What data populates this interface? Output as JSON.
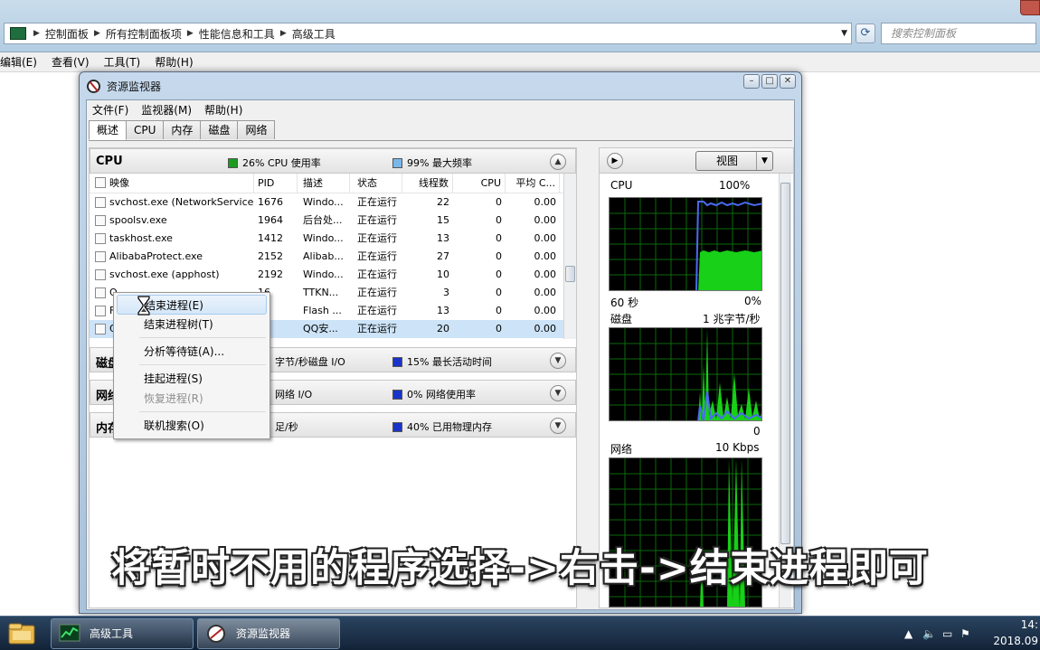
{
  "explorer": {
    "breadcrumbs": [
      "控制面板",
      "所有控制面板项",
      "性能信息和工具",
      "高级工具"
    ],
    "search_placeholder": "搜索控制面板",
    "menu": [
      "编辑(E)",
      "查看(V)",
      "工具(T)",
      "帮助(H)"
    ]
  },
  "resmon": {
    "title": "资源监视器",
    "menu": [
      "文件(F)",
      "监视器(M)",
      "帮助(H)"
    ],
    "tabs": [
      "概述",
      "CPU",
      "内存",
      "磁盘",
      "网络"
    ],
    "active_tab": "概述",
    "cpu_panel": {
      "name": "CPU",
      "usage": "26% CPU 使用率",
      "usage_color": "#1c9c1c",
      "freq": "99% 最大频率",
      "freq_color": "#7ab8ea",
      "columns": [
        "映像",
        "PID",
        "描述",
        "状态",
        "线程数",
        "CPU",
        "平均 C..."
      ],
      "rows": [
        {
          "image": "svchost.exe (NetworkService)",
          "pid": "1676",
          "desc": "Windo...",
          "status": "正在运行",
          "threads": "22",
          "cpu": "0",
          "avg": "0.00"
        },
        {
          "image": "spoolsv.exe",
          "pid": "1964",
          "desc": "后台处...",
          "status": "正在运行",
          "threads": "15",
          "cpu": "0",
          "avg": "0.00"
        },
        {
          "image": "taskhost.exe",
          "pid": "1412",
          "desc": "Windo...",
          "status": "正在运行",
          "threads": "13",
          "cpu": "0",
          "avg": "0.00"
        },
        {
          "image": "AlibabaProtect.exe",
          "pid": "2152",
          "desc": "Alibab...",
          "status": "正在运行",
          "threads": "27",
          "cpu": "0",
          "avg": "0.00"
        },
        {
          "image": "svchost.exe (apphost)",
          "pid": "2192",
          "desc": "Windo...",
          "status": "正在运行",
          "threads": "10",
          "cpu": "0",
          "avg": "0.00"
        },
        {
          "image": "Q",
          "pid": "16",
          "desc": "TTKN...",
          "status": "正在运行",
          "threads": "3",
          "cpu": "0",
          "avg": "0.00"
        },
        {
          "image": "F",
          "pid": "",
          "desc": "Flash ...",
          "status": "正在运行",
          "threads": "13",
          "cpu": "0",
          "avg": "0.00"
        },
        {
          "image": "Q",
          "pid": "4",
          "desc": "QQ安...",
          "status": "正在运行",
          "threads": "20",
          "cpu": "0",
          "avg": "0.00"
        }
      ]
    },
    "disk_panel": {
      "name": "磁盘",
      "io": "字节/秒磁盘 I/O",
      "active": "15% 最长活动时间",
      "active_color": "#1a34c8"
    },
    "network_panel": {
      "name": "网络",
      "io": "网络 I/O",
      "usage": "0% 网络使用率",
      "usage_color": "#1a34c8"
    },
    "memory_panel": {
      "name": "内存",
      "faults": "足/秒",
      "used": "40% 已用物理内存",
      "used_color": "#1a34c8"
    },
    "context_menu": {
      "end_process": "结束进程(E)",
      "end_tree": "结束进程树(T)",
      "analyze_wait": "分析等待链(A)...",
      "suspend": "挂起进程(S)",
      "resume": "恢复进程(R)",
      "search_online": "联机搜索(O)"
    },
    "view_button": "视图",
    "graphs": {
      "cpu": {
        "label": "CPU",
        "max": "100%",
        "time": "60 秒",
        "min": "0%"
      },
      "disk": {
        "label": "磁盘",
        "max": "1 兆字节/秒",
        "min": "0"
      },
      "network": {
        "label": "网络",
        "max": "10 Kbps"
      }
    }
  },
  "caption": "将暂时不用的程序选择->右击->结束进程即可",
  "taskbar": {
    "items": [
      "高级工具",
      "资源监视器"
    ],
    "time": "14:",
    "date": "2018.09"
  }
}
